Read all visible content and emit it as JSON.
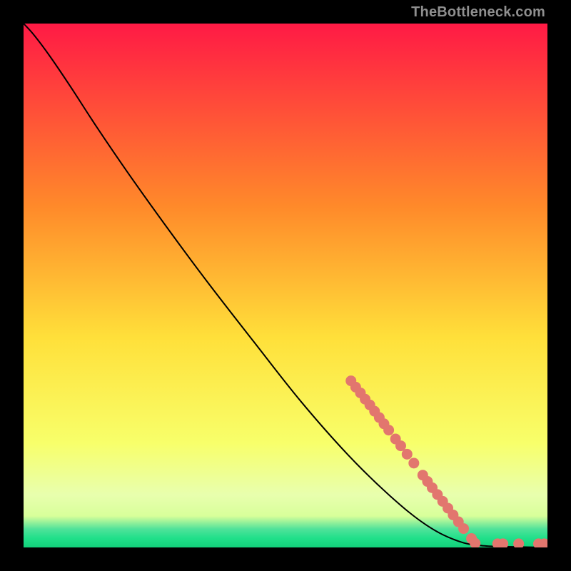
{
  "attribution": "TheBottleneck.com",
  "colors": {
    "bg": "#000000",
    "grad_top": "#ff1a45",
    "grad_mid1": "#ff8a2a",
    "grad_mid2": "#ffe03a",
    "grad_mid3": "#f8ff6a",
    "grad_low": "#d8ff9a",
    "grad_green_top": "#4fe29a",
    "grad_green_mid": "#21e08a",
    "grad_green_bot": "#12d07a",
    "curve": "#000000",
    "dot_fill": "#e2766e",
    "dot_stroke": "#c95f58"
  },
  "chart_data": {
    "type": "line",
    "title": "",
    "xlabel": "",
    "ylabel": "",
    "xlim": [
      0,
      100
    ],
    "ylim": [
      0,
      100
    ],
    "grid": false,
    "curve": [
      {
        "x": 0.0,
        "y": 100.0
      },
      {
        "x": 2.0,
        "y": 97.8
      },
      {
        "x": 5.0,
        "y": 93.8
      },
      {
        "x": 9.0,
        "y": 87.9
      },
      {
        "x": 14.0,
        "y": 80.2
      },
      {
        "x": 20.0,
        "y": 71.4
      },
      {
        "x": 27.0,
        "y": 61.6
      },
      {
        "x": 35.0,
        "y": 50.8
      },
      {
        "x": 44.0,
        "y": 39.2
      },
      {
        "x": 53.0,
        "y": 27.8
      },
      {
        "x": 62.0,
        "y": 17.6
      },
      {
        "x": 70.0,
        "y": 9.8
      },
      {
        "x": 77.0,
        "y": 4.2
      },
      {
        "x": 83.0,
        "y": 1.2
      },
      {
        "x": 88.0,
        "y": 0.3
      },
      {
        "x": 94.0,
        "y": 0.1
      },
      {
        "x": 100.0,
        "y": 0.0
      }
    ],
    "highlight_points": [
      {
        "x": 62.5,
        "y": 31.8
      },
      {
        "x": 63.4,
        "y": 30.6
      },
      {
        "x": 64.3,
        "y": 29.5
      },
      {
        "x": 65.2,
        "y": 28.3
      },
      {
        "x": 66.1,
        "y": 27.2
      },
      {
        "x": 67.0,
        "y": 26.0
      },
      {
        "x": 67.9,
        "y": 24.8
      },
      {
        "x": 68.8,
        "y": 23.6
      },
      {
        "x": 69.7,
        "y": 22.4
      },
      {
        "x": 71.0,
        "y": 20.7
      },
      {
        "x": 72.0,
        "y": 19.4
      },
      {
        "x": 73.2,
        "y": 17.8
      },
      {
        "x": 74.5,
        "y": 16.1
      },
      {
        "x": 76.2,
        "y": 13.8
      },
      {
        "x": 77.1,
        "y": 12.6
      },
      {
        "x": 78.0,
        "y": 11.4
      },
      {
        "x": 79.0,
        "y": 10.1
      },
      {
        "x": 80.0,
        "y": 8.8
      },
      {
        "x": 81.0,
        "y": 7.5
      },
      {
        "x": 82.0,
        "y": 6.2
      },
      {
        "x": 83.0,
        "y": 4.9
      },
      {
        "x": 84.0,
        "y": 3.6
      },
      {
        "x": 85.5,
        "y": 1.7
      },
      {
        "x": 86.2,
        "y": 0.8
      },
      {
        "x": 90.5,
        "y": 0.7
      },
      {
        "x": 91.5,
        "y": 0.7
      },
      {
        "x": 94.5,
        "y": 0.7
      },
      {
        "x": 98.3,
        "y": 0.7
      },
      {
        "x": 99.4,
        "y": 0.7
      }
    ]
  }
}
